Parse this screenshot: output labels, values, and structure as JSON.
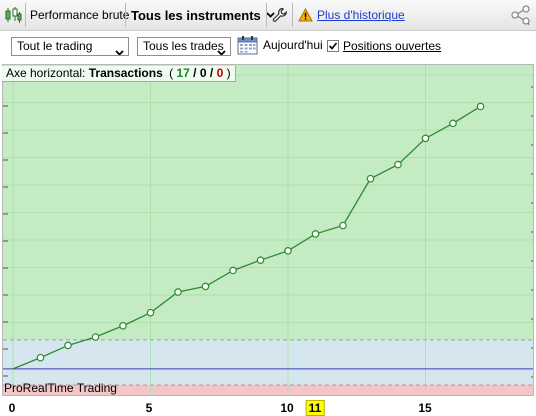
{
  "toolbar": {
    "mode_label": "Performance brute",
    "instrument_label": "Tous les instruments",
    "history_link": "Plus d'historique",
    "icons": [
      "chart-candles-icon",
      "chevron-down-icon",
      "wrench-icon",
      "warning-icon",
      "share-icon"
    ]
  },
  "filters": {
    "scope_select": "Tout le trading",
    "trades_select": "Tous les trades",
    "today_label": "Aujourd'hui",
    "open_positions_label": "Positions ouvertes",
    "open_positions_checked": true
  },
  "chart_header": {
    "axis_label": "Axe horizontal:",
    "axis_value": "Transactions",
    "open_paren": "(",
    "close_paren": ")",
    "sep1": "/",
    "sep2": "/",
    "count_total": "17",
    "count_mid": "0",
    "count_neg": "0",
    "colors": {
      "total": "#1a8a1a",
      "mid": "#000000",
      "neg": "#c00000"
    }
  },
  "footer_label": "ProRealTime Trading",
  "chart_data": {
    "type": "line",
    "x": [
      0,
      1,
      2,
      3,
      4,
      5,
      6,
      7,
      8,
      9,
      10,
      11,
      12,
      13,
      14,
      15,
      16,
      17
    ],
    "y": [
      0,
      1.2,
      2.5,
      3.4,
      4.6,
      6.0,
      8.2,
      8.8,
      10.5,
      11.6,
      12.6,
      14.4,
      15.3,
      20.3,
      21.8,
      24.6,
      26.2,
      28.0
    ],
    "xlim": [
      0,
      19
    ],
    "ylim": [
      -3,
      32
    ],
    "xticks": [
      0,
      5,
      10,
      15
    ],
    "highlight_x": "11",
    "zero_line": 0,
    "colors": {
      "line": "#2e8b2e",
      "marker_fill": "#ffffff",
      "profit_zone": "#c4ebc4",
      "neutral_zone": "#d6e6ef",
      "loss_zone": "#f2c6c6",
      "zero_line": "#3a3ab8"
    }
  }
}
